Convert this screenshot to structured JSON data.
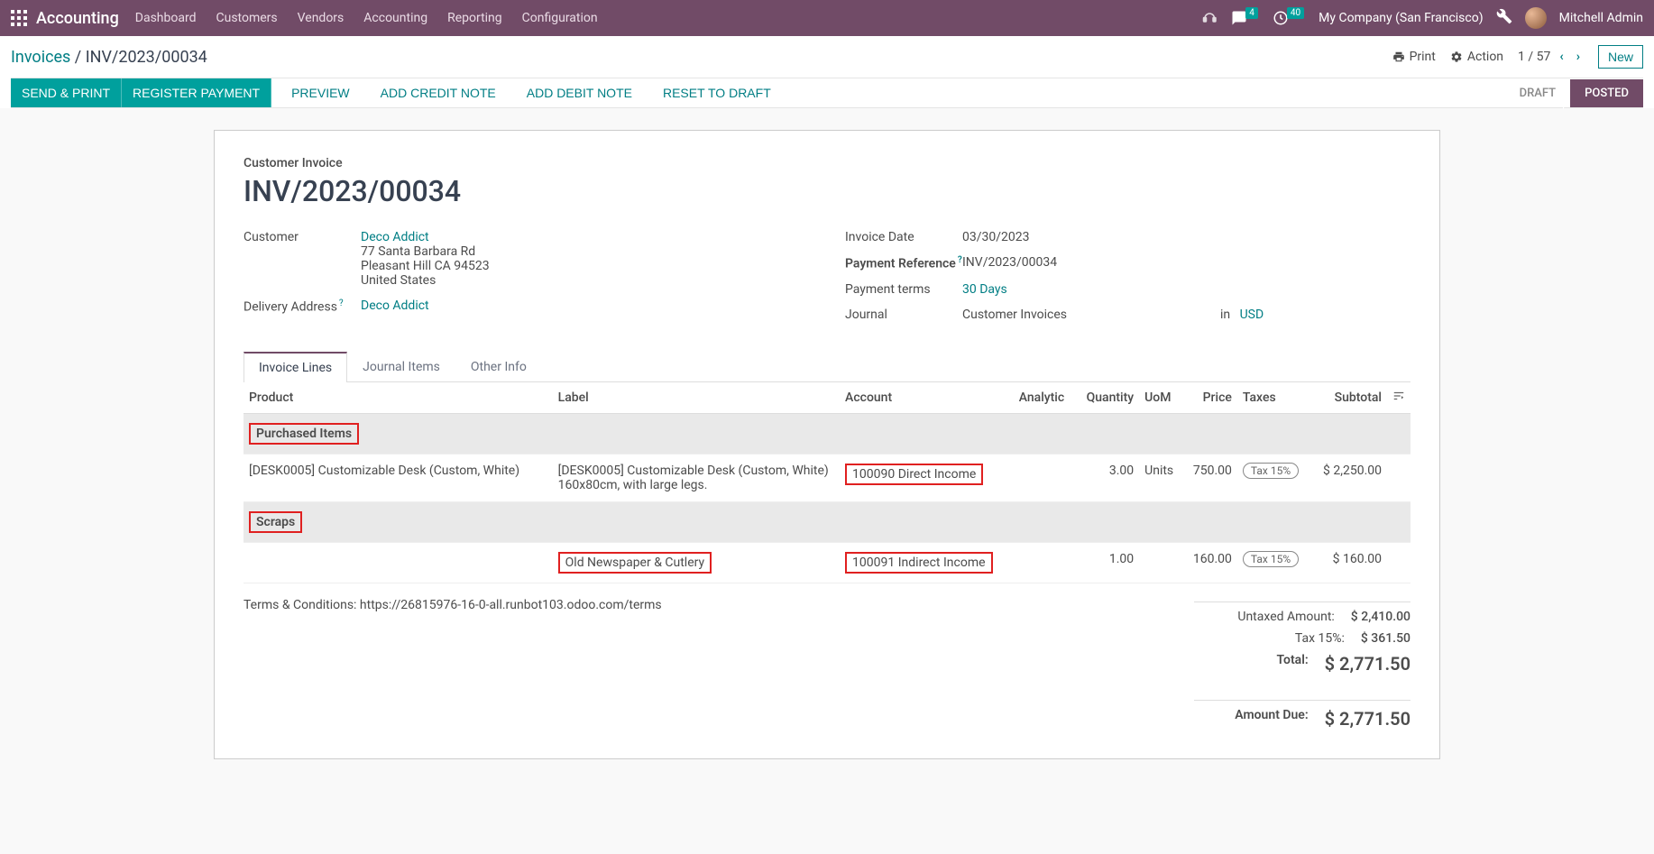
{
  "nav": {
    "brand": "Accounting",
    "menu": [
      "Dashboard",
      "Customers",
      "Vendors",
      "Accounting",
      "Reporting",
      "Configuration"
    ],
    "badge_chat": "4",
    "badge_clock": "40",
    "company": "My Company (San Francisco)",
    "user": "Mitchell Admin"
  },
  "breadcrumb": {
    "parent": "Invoices",
    "current": "INV/2023/00034"
  },
  "controls": {
    "print": "Print",
    "action": "Action",
    "pager": "1 / 57",
    "new": "New"
  },
  "actions": {
    "send_print": "SEND & PRINT",
    "register_payment": "REGISTER PAYMENT",
    "preview": "PREVIEW",
    "credit_note": "ADD CREDIT NOTE",
    "debit_note": "ADD DEBIT NOTE",
    "reset_draft": "RESET TO DRAFT"
  },
  "status": {
    "draft": "DRAFT",
    "posted": "POSTED"
  },
  "sheet": {
    "type": "Customer Invoice",
    "name": "INV/2023/00034",
    "customer_label": "Customer",
    "customer_name": "Deco Addict",
    "customer_addr1": "77 Santa Barbara Rd",
    "customer_addr2": "Pleasant Hill CA 94523",
    "customer_country": "United States",
    "delivery_label": "Delivery Address",
    "delivery_value": "Deco Addict",
    "invoice_date_label": "Invoice Date",
    "invoice_date": "03/30/2023",
    "payment_ref_label": "Payment Reference",
    "payment_ref": "INV/2023/00034",
    "terms_label": "Payment terms",
    "terms_value": "30 Days",
    "journal_label": "Journal",
    "journal_value": "Customer Invoices",
    "journal_in": "in",
    "journal_currency": "USD"
  },
  "tabs": {
    "lines": "Invoice Lines",
    "journal": "Journal Items",
    "other": "Other Info"
  },
  "table": {
    "headers": {
      "product": "Product",
      "label": "Label",
      "account": "Account",
      "analytic": "Analytic",
      "quantity": "Quantity",
      "uom": "UoM",
      "price": "Price",
      "taxes": "Taxes",
      "subtotal": "Subtotal"
    },
    "section1": "Purchased Items",
    "row1": {
      "product": "[DESK0005] Customizable Desk (Custom, White)",
      "label": "[DESK0005] Customizable Desk (Custom, White) 160x80cm, with large legs.",
      "account": "100090 Direct Income",
      "qty": "3.00",
      "uom": "Units",
      "price": "750.00",
      "tax": "Tax 15%",
      "subtotal": "$ 2,250.00"
    },
    "section2": "Scraps",
    "row2": {
      "product": "",
      "label": "Old Newspaper & Cutlery",
      "account": "100091 Indirect Income",
      "qty": "1.00",
      "uom": "",
      "price": "160.00",
      "tax": "Tax 15%",
      "subtotal": "$ 160.00"
    }
  },
  "terms_text": "Terms & Conditions: https://26815976-16-0-all.runbot103.odoo.com/terms",
  "totals": {
    "untaxed_label": "Untaxed Amount:",
    "untaxed": "$ 2,410.00",
    "tax_label": "Tax 15%:",
    "tax": "$ 361.50",
    "total_label": "Total:",
    "total": "$ 2,771.50",
    "due_label": "Amount Due:",
    "due": "$ 2,771.50"
  }
}
